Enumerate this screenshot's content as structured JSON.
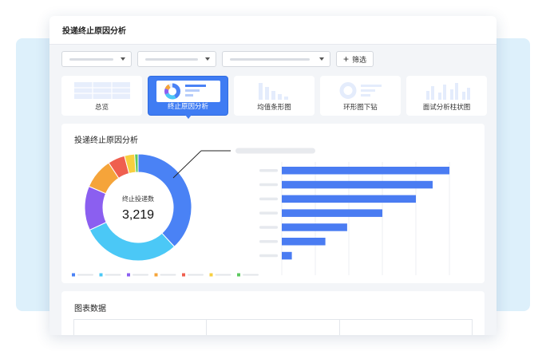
{
  "window": {
    "title": "投递终止原因分析"
  },
  "filters": {
    "selects": [
      {
        "name": "filter-select-1"
      },
      {
        "name": "filter-select-2"
      },
      {
        "name": "filter-select-3"
      }
    ],
    "filter_button_label": "筛选"
  },
  "tabs": [
    {
      "label": "总览",
      "thumb": "table",
      "active": false
    },
    {
      "label": "终止原因分析",
      "thumb": "donut",
      "active": true
    },
    {
      "label": "均值条形图",
      "thumb": "bars",
      "active": false
    },
    {
      "label": "环形图下钻",
      "thumb": "ring",
      "active": false
    },
    {
      "label": "面试分析柱状图",
      "thumb": "columns",
      "active": false
    }
  ],
  "donut_card": {
    "title": "投递终止原因分析",
    "center_label": "终止投递数",
    "center_value": "3,219"
  },
  "table_card": {
    "title": "图表数据"
  },
  "colors": {
    "accent": "#3f7cf3",
    "donut": [
      "#4a82f5",
      "#4bc8f6",
      "#8b5ff0",
      "#f5a43a",
      "#ef5f4f",
      "#f7cf3f",
      "#5cc95f"
    ],
    "bar": "#4a7cf2"
  },
  "chart_data": [
    {
      "type": "pie",
      "values": [
        37,
        29,
        13,
        9,
        5,
        3,
        1
      ]
    },
    {
      "type": "bar",
      "orientation": "horizontal",
      "values": [
        100,
        90,
        80,
        60,
        39,
        26,
        6
      ],
      "xlim": [
        0,
        100
      ],
      "grid": true
    }
  ]
}
